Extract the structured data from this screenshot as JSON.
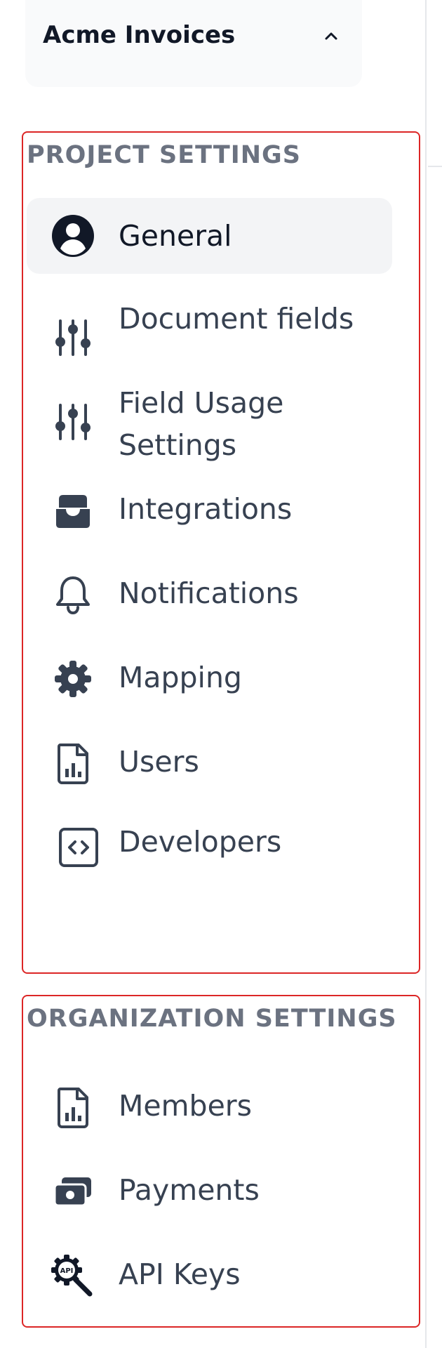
{
  "project_switcher": {
    "name": "Acme Invoices",
    "chevron_icon": "chevron-up-icon"
  },
  "project_settings": {
    "title": "PROJECT SETTINGS",
    "items": [
      {
        "label": "General",
        "icon": "user-circle-icon",
        "active": true
      },
      {
        "label": "Document fields",
        "icon": "sliders-icon",
        "active": false
      },
      {
        "label": "Field Usage Settings",
        "icon": "sliders-icon",
        "active": false
      },
      {
        "label": "Integrations",
        "icon": "inbox-tray-icon",
        "active": false
      },
      {
        "label": "Notifications",
        "icon": "bell-icon",
        "active": false
      },
      {
        "label": "Mapping",
        "icon": "gear-icon",
        "active": false
      },
      {
        "label": "Users",
        "icon": "document-chart-icon",
        "active": false
      },
      {
        "label": "Developers",
        "icon": "code-bracket-icon",
        "active": false
      }
    ]
  },
  "organization_settings": {
    "title": "ORGANIZATION SETTINGS",
    "items": [
      {
        "label": "Members",
        "icon": "document-chart-icon",
        "active": false
      },
      {
        "label": "Payments",
        "icon": "cash-stack-icon",
        "active": false
      },
      {
        "label": "API Keys",
        "icon": "api-key-icon",
        "active": false
      }
    ]
  },
  "colors": {
    "section_border": "#dc2626",
    "active_background": "#f3f4f6",
    "label_text": "#374151",
    "heading_text": "#6b7280"
  }
}
